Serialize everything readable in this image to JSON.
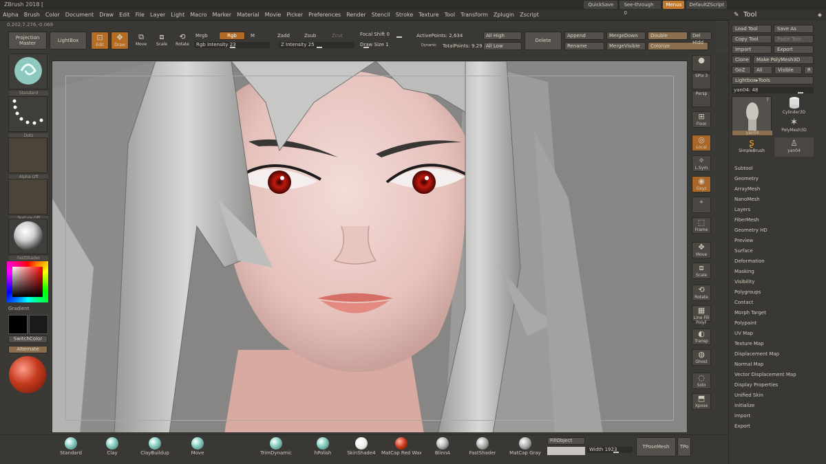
{
  "app": {
    "title": "ZBrush 2018 ["
  },
  "menu": {
    "items": [
      "Alpha",
      "Brush",
      "Color",
      "Document",
      "Draw",
      "Edit",
      "File",
      "Layer",
      "Light",
      "Macro",
      "Marker",
      "Material",
      "Movie",
      "Picker",
      "Preferences",
      "Render",
      "Stencil",
      "Stroke",
      "Texture",
      "Tool",
      "Transform",
      "Zplugin",
      "Zscript"
    ],
    "quicksave": "QuickSave",
    "see_through": "See-through 0",
    "menus": "Menus",
    "default_zscript": "DefaultZScript"
  },
  "coords": "0.202,7.276,-0.069",
  "shelf": {
    "projection_master": "Projection Master",
    "lightbox": "LightBox",
    "edit": "Edit",
    "draw": "Draw",
    "move": "Move",
    "scale": "Scale",
    "rotate": "Rotate",
    "mrgb": "Mrgb",
    "rgb": "Rgb",
    "m": "M",
    "zadd": "Zadd",
    "zsub": "Zsub",
    "zcut": "Zcut",
    "rgb_intensity_label": "Rgb Intensity",
    "rgb_intensity": "23",
    "z_intensity_label": "Z Intensity",
    "z_intensity": "25",
    "focal_shift_label": "Focal Shift",
    "focal_shift": "0",
    "draw_size_label": "Draw Size",
    "draw_size": "1",
    "dynamic": "Dynamic",
    "active_points": "ActivePoints: 2,634",
    "total_points": "TotalPoints: 9.29",
    "all_high": "All High",
    "all_low": "All Low",
    "delete": "Delete",
    "append": "Append",
    "rename": "Rename",
    "merge_down": "MergeDown",
    "merge_visible": "MergeVisible",
    "double": "Double",
    "colorize": "Colorize",
    "del_hidden": "Del Hidd"
  },
  "left": {
    "brush": "Standard",
    "stroke": "Dots",
    "alpha": "Alpha Off",
    "texture": "Texture Off",
    "material": "FastShader",
    "gradient": "Gradient",
    "switch_color": "SwitchColor",
    "alternate": "Alternate"
  },
  "right": {
    "buttons": [
      "",
      "SPix 3",
      "Persp",
      "Floor",
      "Local",
      "L.Sym",
      "Gxyz",
      "",
      "Frame",
      "Move",
      "Scale",
      "Rotate",
      "Line Fill PolyF",
      "Transp",
      "Ghost",
      "Solo",
      "Xpose"
    ]
  },
  "tool": {
    "title": "Tool",
    "load_tool": "Load Tool",
    "save_as": "Save As",
    "copy_tool": "Copy Tool",
    "paste_tool": "Paste Tool",
    "import": "Import",
    "export": "Export",
    "clone": "Clone",
    "make_polymesh": "Make PolyMesh3D",
    "goz": "GoZ",
    "all": "All",
    "visible": "Visible",
    "r": "R",
    "lightbox_tools": "Lightbox▸Tools",
    "current_tool": "yan04: 48",
    "thumbs": [
      "yan04",
      "Cylinder3D",
      "PolyMesh3D",
      "SimpleBrush",
      "yan04"
    ],
    "thumb_badge": "7",
    "subpalettes": [
      "Subtool",
      "Geometry",
      "ArrayMesh",
      "NanoMesh",
      "Layers",
      "FiberMesh",
      "Geometry HD",
      "Preview",
      "Surface",
      "Deformation",
      "Masking",
      "Visibility",
      "Polygroups",
      "Contact",
      "Morph Target",
      "Polypaint",
      "UV Map",
      "Texture Map",
      "Displacement Map",
      "Normal Map",
      "Vector Displacement Map",
      "Display Properties",
      "Unified Skin",
      "Initialize",
      "Import",
      "Export"
    ]
  },
  "bottom": {
    "brushes": [
      "Standard",
      "Clay",
      "ClayBuildup",
      "Move",
      "TrimDynamic",
      "hPolish"
    ],
    "materials": [
      "SkinShade4",
      "MatCap Red Wax",
      "BlinnA",
      "FastShader",
      "MatCap Gray"
    ],
    "fill_object": "FillObject",
    "width_label": "Width",
    "width_value": "1923",
    "tpose_mesh": "TPoseMesh",
    "tpo": "TPo"
  },
  "colors": {
    "accent": "#b36a23",
    "panel": "#3a3835",
    "viewport": "#878684"
  }
}
